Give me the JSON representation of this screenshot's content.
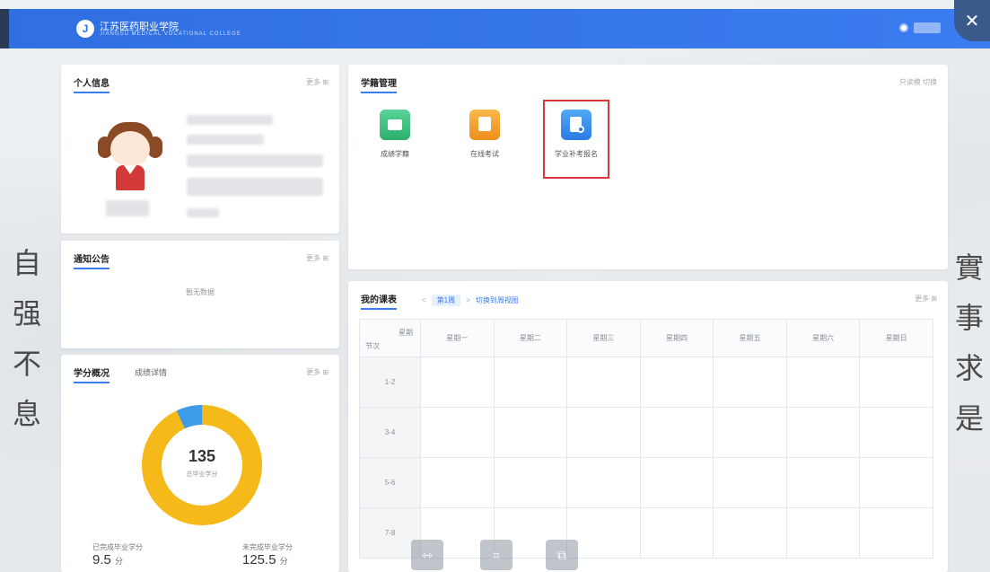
{
  "header": {
    "logo_mark": "J",
    "logo_text": "江苏医药职业学院",
    "logo_subtext": "JIANGSU MEDICAL VOCATIONAL COLLEGE",
    "close_label": "✕"
  },
  "profile": {
    "title": "个人信息",
    "more": "更多 ⊞"
  },
  "notice": {
    "title": "通知公告",
    "more": "更多 ⊞",
    "empty": "暂无数据"
  },
  "credit": {
    "title": "学分概况",
    "subtab": "成绩详情",
    "more": "更多 ⊞",
    "total": "135",
    "total_label": "总毕业学分",
    "earned_label": "已完成毕业学分",
    "earned_value": "9.5",
    "remaining_label": "未完成毕业学分",
    "remaining_value": "125.5",
    "unit": "分",
    "earned_fraction": 0.07,
    "colors": {
      "earned": "#3d9be9",
      "remaining": "#f6b91a"
    }
  },
  "academic": {
    "title": "学籍管理",
    "more": "只读模 切换",
    "apps": [
      {
        "label": "成绩学籍",
        "icon": "folder-icon",
        "color": "#3bbf7a"
      },
      {
        "label": "在线考试",
        "icon": "exam-icon",
        "color": "#f2a123"
      },
      {
        "label": "学业补考报名",
        "icon": "register-icon",
        "color": "#2f8ef0"
      }
    ]
  },
  "schedule": {
    "title": "我的课表",
    "week": "第1周",
    "view_link": "切换到周视图",
    "more": "更多 ⊞",
    "corner_top": "星期",
    "corner_bottom": "节次",
    "days": [
      "星期一",
      "星期二",
      "星期三",
      "星期四",
      "星期五",
      "星期六",
      "星期日"
    ],
    "periods": [
      "1-2",
      "3-4",
      "5-6",
      "7-8"
    ]
  },
  "calligraphy": {
    "left": [
      "自",
      "强",
      "不",
      "息"
    ],
    "right": [
      "實",
      "事",
      "求",
      "是"
    ]
  }
}
